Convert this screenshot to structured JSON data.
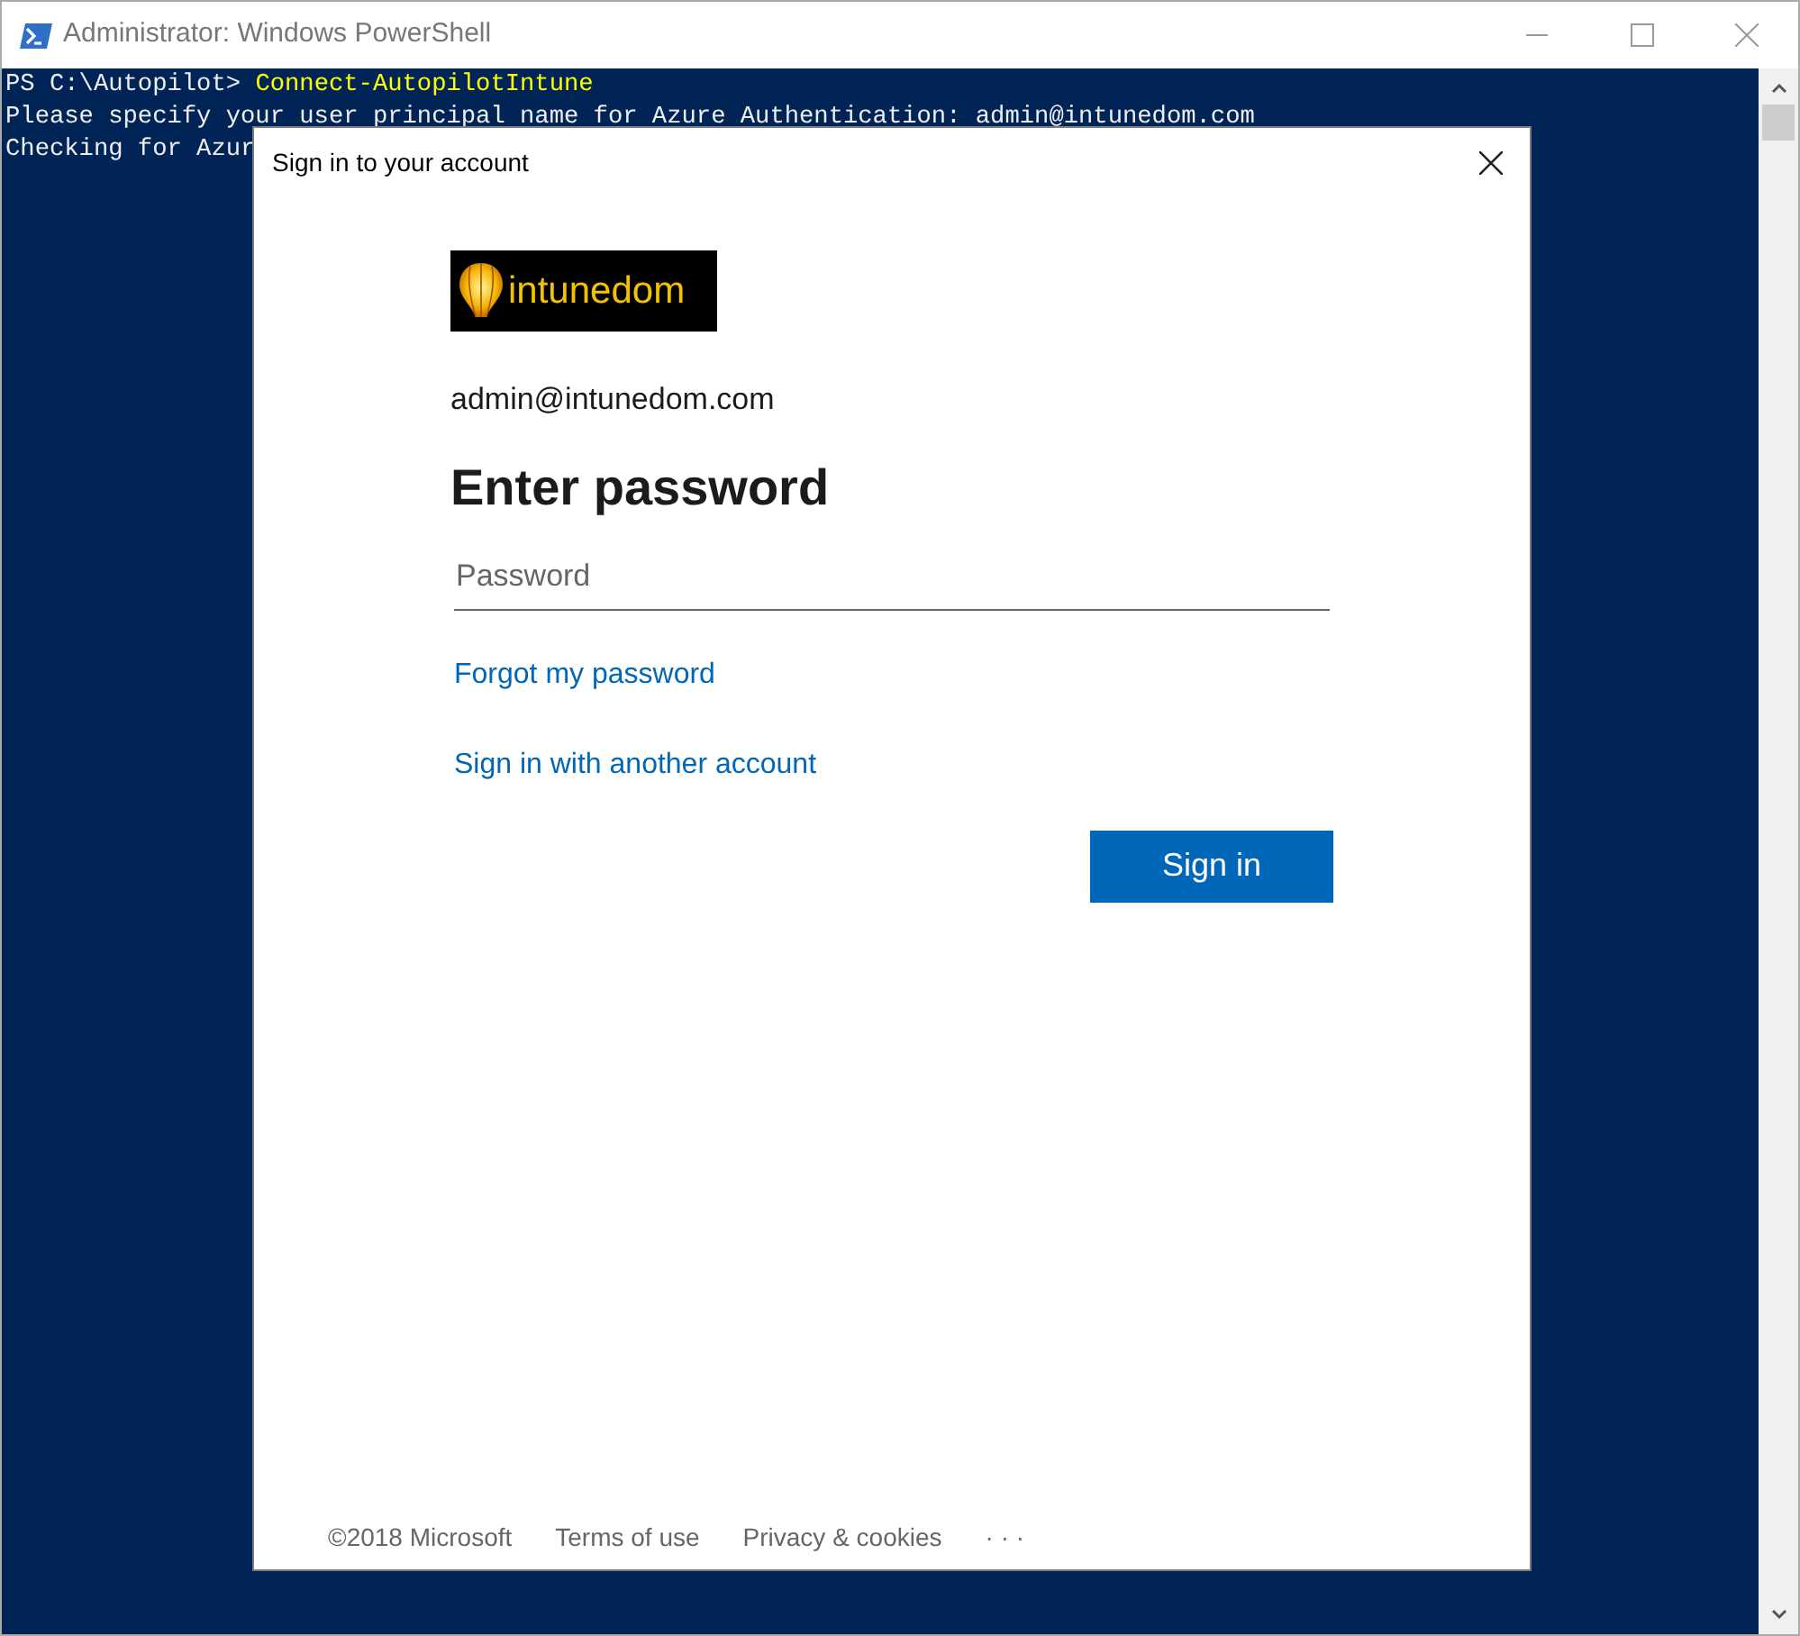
{
  "window": {
    "title": "Administrator: Windows PowerShell"
  },
  "console": {
    "lines": [
      {
        "kind": "prompt",
        "prompt": "PS C:\\Autopilot> ",
        "command": "Connect-AutopilotIntune"
      },
      {
        "kind": "output",
        "text": "Please specify your user principal name for Azure Authentication: admin@intunedom.com"
      },
      {
        "kind": "output",
        "text": "Checking for Azur"
      }
    ]
  },
  "dialog": {
    "title": "Sign in to your account",
    "logo_text": "intunedom",
    "account": "admin@intunedom.com",
    "heading": "Enter password",
    "password": {
      "placeholder": "Password"
    },
    "links": [
      "Forgot my password",
      "Sign in with another account"
    ],
    "button": "Sign in",
    "copyright": "©2018 Microsoft",
    "footer_links": [
      "Terms of use",
      "Privacy & cookies",
      "· · ·"
    ]
  }
}
